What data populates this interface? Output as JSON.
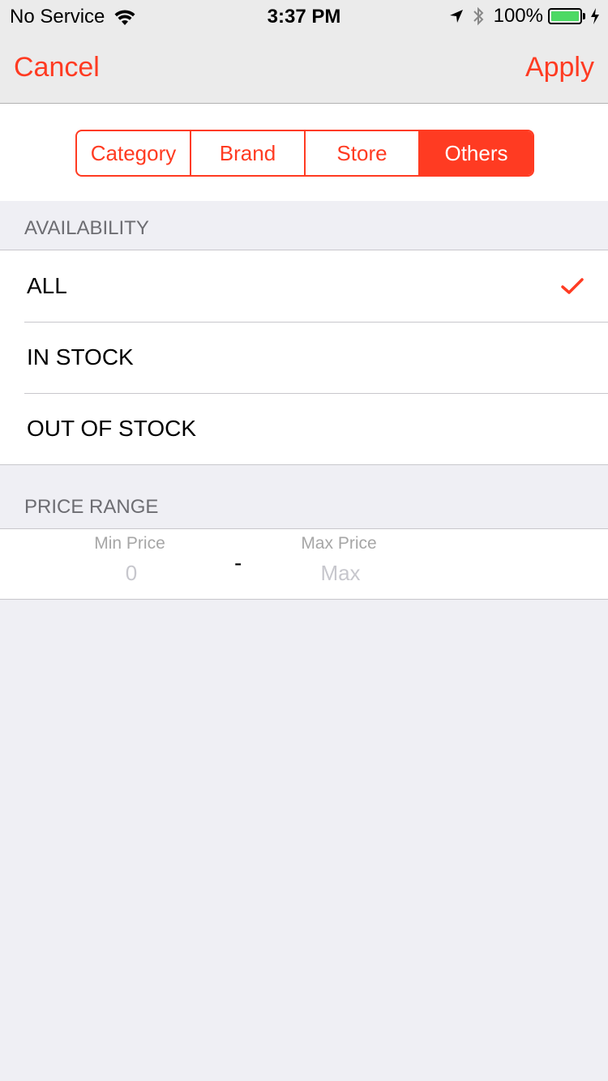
{
  "status_bar": {
    "carrier": "No Service",
    "time": "3:37 PM",
    "battery_percent": "100%",
    "battery_color": "#4cd964"
  },
  "nav": {
    "cancel_label": "Cancel",
    "apply_label": "Apply"
  },
  "segments": {
    "items": [
      {
        "label": "Category",
        "selected": false
      },
      {
        "label": "Brand",
        "selected": false
      },
      {
        "label": "Store",
        "selected": false
      },
      {
        "label": "Others",
        "selected": true
      }
    ]
  },
  "availability": {
    "header": "AVAILABILITY",
    "options": [
      {
        "label": "ALL",
        "checked": true
      },
      {
        "label": "IN STOCK",
        "checked": false
      },
      {
        "label": "OUT OF STOCK",
        "checked": false
      }
    ]
  },
  "price_range": {
    "header": "PRICE RANGE",
    "min_label": "Min Price",
    "min_placeholder": "0",
    "separator": "-",
    "max_label": "Max Price",
    "max_placeholder": "Max"
  },
  "colors": {
    "accent": "#ff3b22",
    "background": "#efeff4"
  }
}
